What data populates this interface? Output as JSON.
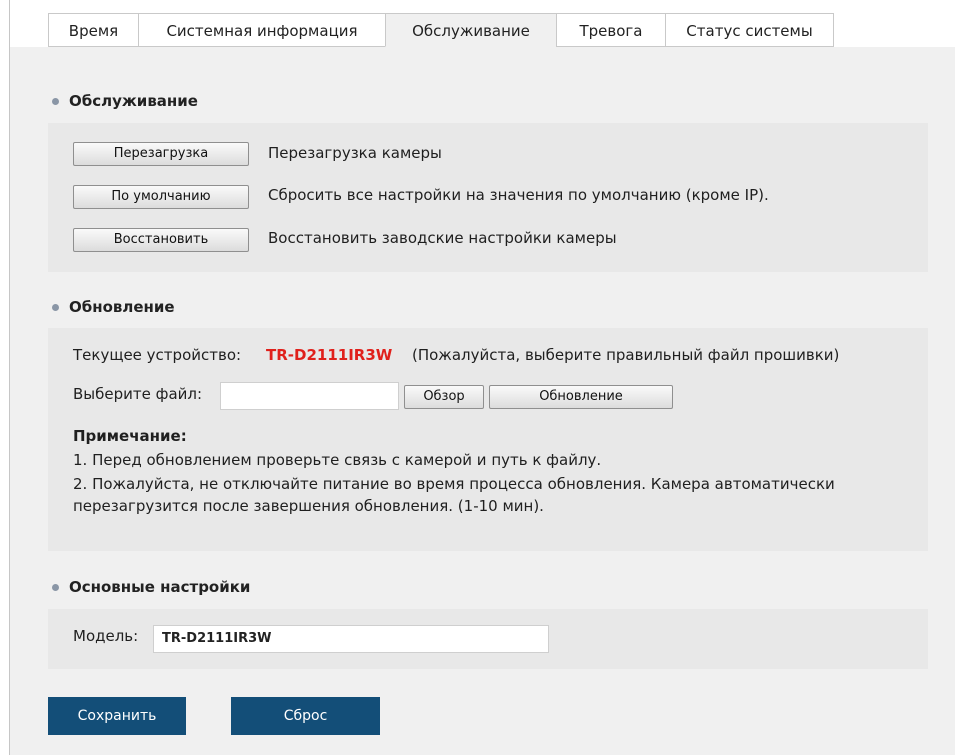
{
  "tabs": [
    {
      "label": "Время"
    },
    {
      "label": "Системная информация"
    },
    {
      "label": "Обслуживание",
      "active": true
    },
    {
      "label": "Тревога"
    },
    {
      "label": "Статус системы"
    }
  ],
  "maintenance": {
    "title": "Обслуживание",
    "reboot_button": "Перезагрузка",
    "reboot_desc": "Перезагрузка камеры",
    "default_button": "По умолчанию",
    "default_desc": "Сбросить все настройки на значения по умолчанию (кроме IP).",
    "restore_button": "Восстановить",
    "restore_desc": "Восстановить заводские настройки камеры"
  },
  "update": {
    "title": "Обновление",
    "current_device_label": "Текущее устройство:",
    "device_model": "TR-D2111IR3W",
    "device_hint": "(Пожалуйста, выберите правильный файл прошивки)",
    "choose_file_label": "Выберите файл:",
    "file_value": "",
    "browse_button": "Обзор",
    "update_button": "Обновление",
    "note_title": "Примечание:",
    "note_1": "1. Перед обновлением проверьте связь с камерой и путь к файлу.",
    "note_2a": "2. Пожалуйста, не отключайте питание во время процесса обновления. Камера автоматически",
    "note_2b": "перезагрузится после завершения обновления. (1-10 мин)."
  },
  "basic": {
    "title": "Основные настройки",
    "model_label": "Модель:",
    "model_value": "TR-D2111IR3W"
  },
  "actions": {
    "save": "Сохранить",
    "reset": "Сброс"
  },
  "colors": {
    "accent": "#134e78",
    "device_red": "#e0201b",
    "panel_bg": "#f0f0f0",
    "box_bg": "#e8e8e8"
  }
}
